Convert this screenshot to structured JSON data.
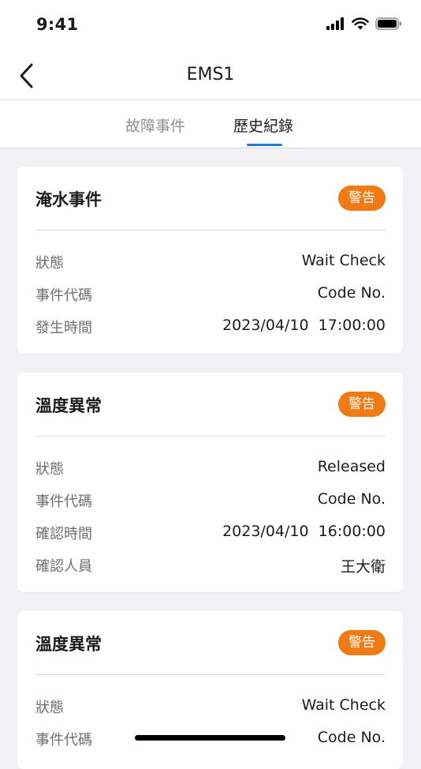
{
  "status_bar": {
    "time": "9:41"
  },
  "nav": {
    "title": "EMS1"
  },
  "tabs": [
    {
      "label": "故障事件",
      "active": false
    },
    {
      "label": "歷史紀錄",
      "active": true
    }
  ],
  "colors": {
    "badge": "#f07b14",
    "accent": "#1f7ae0"
  },
  "cards": [
    {
      "title": "淹水事件",
      "badge": "警告",
      "rows": [
        {
          "label": "狀態",
          "value": "Wait Check"
        },
        {
          "label": "事件代碼",
          "value": "Code No."
        },
        {
          "label": "發生時間",
          "value": "2023/04/10  17:00:00"
        }
      ]
    },
    {
      "title": "溫度異常",
      "badge": "警告",
      "rows": [
        {
          "label": "狀態",
          "value": "Released"
        },
        {
          "label": "事件代碼",
          "value": "Code No."
        },
        {
          "label": "確認時間",
          "value": "2023/04/10  16:00:00"
        },
        {
          "label": "確認人員",
          "value": "王大衛"
        }
      ]
    },
    {
      "title": "溫度異常",
      "badge": "警告",
      "rows": [
        {
          "label": "狀態",
          "value": "Wait Check"
        },
        {
          "label": "事件代碼",
          "value": "Code No."
        }
      ]
    }
  ]
}
